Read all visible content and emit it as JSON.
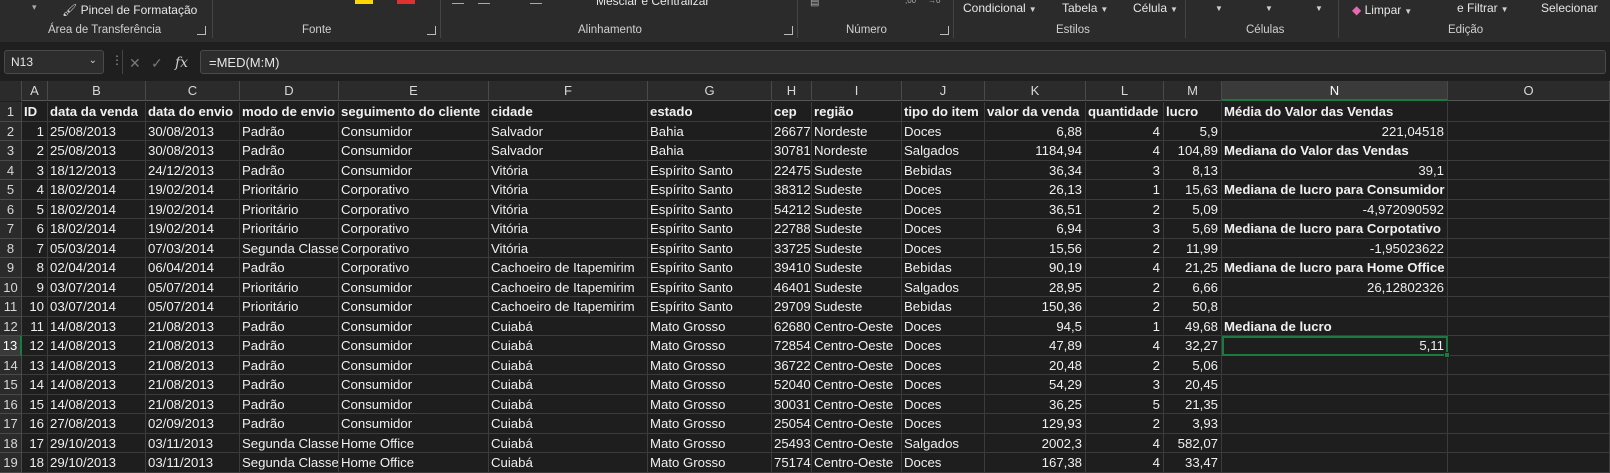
{
  "ribbon": {
    "clipboard": {
      "format_painter": "Pincel de Formatação",
      "group": "Área de Transferência"
    },
    "font": {
      "group": "Fonte"
    },
    "alignment": {
      "merge": "Mesclar e Centralizar",
      "group": "Alinhamento"
    },
    "number": {
      "group": "Número"
    },
    "styles": {
      "conditional": "Condicional",
      "table": "Tabela",
      "cell": "Célula",
      "group": "Estilos"
    },
    "cells": {
      "group": "Células"
    },
    "editing": {
      "clear": "Limpar",
      "filter": "e Filtrar",
      "select": "Selecionar",
      "group": "Edição"
    },
    "colors": {
      "highlight": "#ffd700",
      "font_color": "#e03030"
    }
  },
  "formula_bar": {
    "name_box": "N13",
    "formula": "=MED(M:M)"
  },
  "columns": [
    "A",
    "B",
    "C",
    "D",
    "E",
    "F",
    "G",
    "H",
    "I",
    "J",
    "K",
    "L",
    "M",
    "N",
    "O"
  ],
  "selected_column": "N",
  "selected_row": "13",
  "rows": [
    {
      "n": "1",
      "cells": [
        "ID",
        "data da venda",
        "data do envio",
        "modo de envio",
        "seguimento do cliente",
        "cidade",
        "estado",
        "cep",
        "região",
        "tipo do item",
        "valor da venda",
        "quantidade",
        "lucro",
        "Média do Valor das Vendas",
        ""
      ]
    },
    {
      "n": "2",
      "cells": [
        "1",
        "25/08/2013",
        "30/08/2013",
        "Padrão",
        "Consumidor",
        "Salvador",
        "Bahia",
        "26677",
        "Nordeste",
        "Doces",
        "6,88",
        "4",
        "5,9",
        "221,04518",
        ""
      ]
    },
    {
      "n": "3",
      "cells": [
        "2",
        "25/08/2013",
        "30/08/2013",
        "Padrão",
        "Consumidor",
        "Salvador",
        "Bahia",
        "30781",
        "Nordeste",
        "Salgados",
        "1184,94",
        "4",
        "104,89",
        "Mediana do Valor das Vendas",
        ""
      ]
    },
    {
      "n": "4",
      "cells": [
        "3",
        "18/12/2013",
        "24/12/2013",
        "Padrão",
        "Consumidor",
        "Vitória",
        "Espírito Santo",
        "22475",
        "Sudeste",
        "Bebidas",
        "36,34",
        "3",
        "8,13",
        "39,1",
        ""
      ]
    },
    {
      "n": "5",
      "cells": [
        "4",
        "18/02/2014",
        "19/02/2014",
        "Prioritário",
        "Corporativo",
        "Vitória",
        "Espírito Santo",
        "38312",
        "Sudeste",
        "Doces",
        "26,13",
        "1",
        "15,63",
        "Mediana de lucro para Consumidor",
        ""
      ]
    },
    {
      "n": "6",
      "cells": [
        "5",
        "18/02/2014",
        "19/02/2014",
        "Prioritário",
        "Corporativo",
        "Vitória",
        "Espírito Santo",
        "54212",
        "Sudeste",
        "Doces",
        "36,51",
        "2",
        "5,09",
        "-4,972090592",
        ""
      ]
    },
    {
      "n": "7",
      "cells": [
        "6",
        "18/02/2014",
        "19/02/2014",
        "Prioritário",
        "Corporativo",
        "Vitória",
        "Espírito Santo",
        "22788",
        "Sudeste",
        "Doces",
        "6,94",
        "3",
        "5,69",
        "Mediana de lucro para Corpotativo",
        ""
      ]
    },
    {
      "n": "8",
      "cells": [
        "7",
        "05/03/2014",
        "07/03/2014",
        "Segunda Classe",
        "Corporativo",
        "Vitória",
        "Espírito Santo",
        "33725",
        "Sudeste",
        "Doces",
        "15,56",
        "2",
        "11,99",
        "-1,95023622",
        ""
      ]
    },
    {
      "n": "9",
      "cells": [
        "8",
        "02/04/2014",
        "06/04/2014",
        "Padrão",
        "Corporativo",
        "Cachoeiro de Itapemirim",
        "Espírito Santo",
        "39410",
        "Sudeste",
        "Bebidas",
        "90,19",
        "4",
        "21,25",
        "Mediana de lucro para Home Office",
        ""
      ]
    },
    {
      "n": "10",
      "cells": [
        "9",
        "03/07/2014",
        "05/07/2014",
        "Prioritário",
        "Consumidor",
        "Cachoeiro de Itapemirim",
        "Espírito Santo",
        "46401",
        "Sudeste",
        "Salgados",
        "28,95",
        "2",
        "6,66",
        "26,12802326",
        ""
      ]
    },
    {
      "n": "11",
      "cells": [
        "10",
        "03/07/2014",
        "05/07/2014",
        "Prioritário",
        "Consumidor",
        "Cachoeiro de Itapemirim",
        "Espírito Santo",
        "29709",
        "Sudeste",
        "Bebidas",
        "150,36",
        "2",
        "50,8",
        "",
        ""
      ]
    },
    {
      "n": "12",
      "cells": [
        "11",
        "14/08/2013",
        "21/08/2013",
        "Padrão",
        "Consumidor",
        "Cuiabá",
        "Mato Grosso",
        "62680",
        "Centro-Oeste",
        "Doces",
        "94,5",
        "1",
        "49,68",
        "Mediana de lucro",
        ""
      ]
    },
    {
      "n": "13",
      "cells": [
        "12",
        "14/08/2013",
        "21/08/2013",
        "Padrão",
        "Consumidor",
        "Cuiabá",
        "Mato Grosso",
        "72854",
        "Centro-Oeste",
        "Doces",
        "47,89",
        "4",
        "32,27",
        "5,11",
        ""
      ]
    },
    {
      "n": "14",
      "cells": [
        "13",
        "14/08/2013",
        "21/08/2013",
        "Padrão",
        "Consumidor",
        "Cuiabá",
        "Mato Grosso",
        "36722",
        "Centro-Oeste",
        "Doces",
        "20,48",
        "2",
        "5,06",
        "",
        ""
      ]
    },
    {
      "n": "15",
      "cells": [
        "14",
        "14/08/2013",
        "21/08/2013",
        "Padrão",
        "Consumidor",
        "Cuiabá",
        "Mato Grosso",
        "52040",
        "Centro-Oeste",
        "Doces",
        "54,29",
        "3",
        "20,45",
        "",
        ""
      ]
    },
    {
      "n": "16",
      "cells": [
        "15",
        "14/08/2013",
        "21/08/2013",
        "Padrão",
        "Consumidor",
        "Cuiabá",
        "Mato Grosso",
        "30031",
        "Centro-Oeste",
        "Doces",
        "36,25",
        "5",
        "21,35",
        "",
        ""
      ]
    },
    {
      "n": "17",
      "cells": [
        "16",
        "27/08/2013",
        "02/09/2013",
        "Padrão",
        "Consumidor",
        "Cuiabá",
        "Mato Grosso",
        "25054",
        "Centro-Oeste",
        "Doces",
        "129,93",
        "2",
        "3,93",
        "",
        ""
      ]
    },
    {
      "n": "18",
      "cells": [
        "17",
        "29/10/2013",
        "03/11/2013",
        "Segunda Classe",
        "Home Office",
        "Cuiabá",
        "Mato Grosso",
        "25493",
        "Centro-Oeste",
        "Salgados",
        "2002,3",
        "4",
        "582,07",
        "",
        ""
      ]
    },
    {
      "n": "19",
      "cells": [
        "18",
        "29/10/2013",
        "03/11/2013",
        "Segunda Classe",
        "Home Office",
        "Cuiabá",
        "Mato Grosso",
        "75174",
        "Centro-Oeste",
        "Doces",
        "167,38",
        "4",
        "33,47",
        "",
        ""
      ]
    }
  ]
}
